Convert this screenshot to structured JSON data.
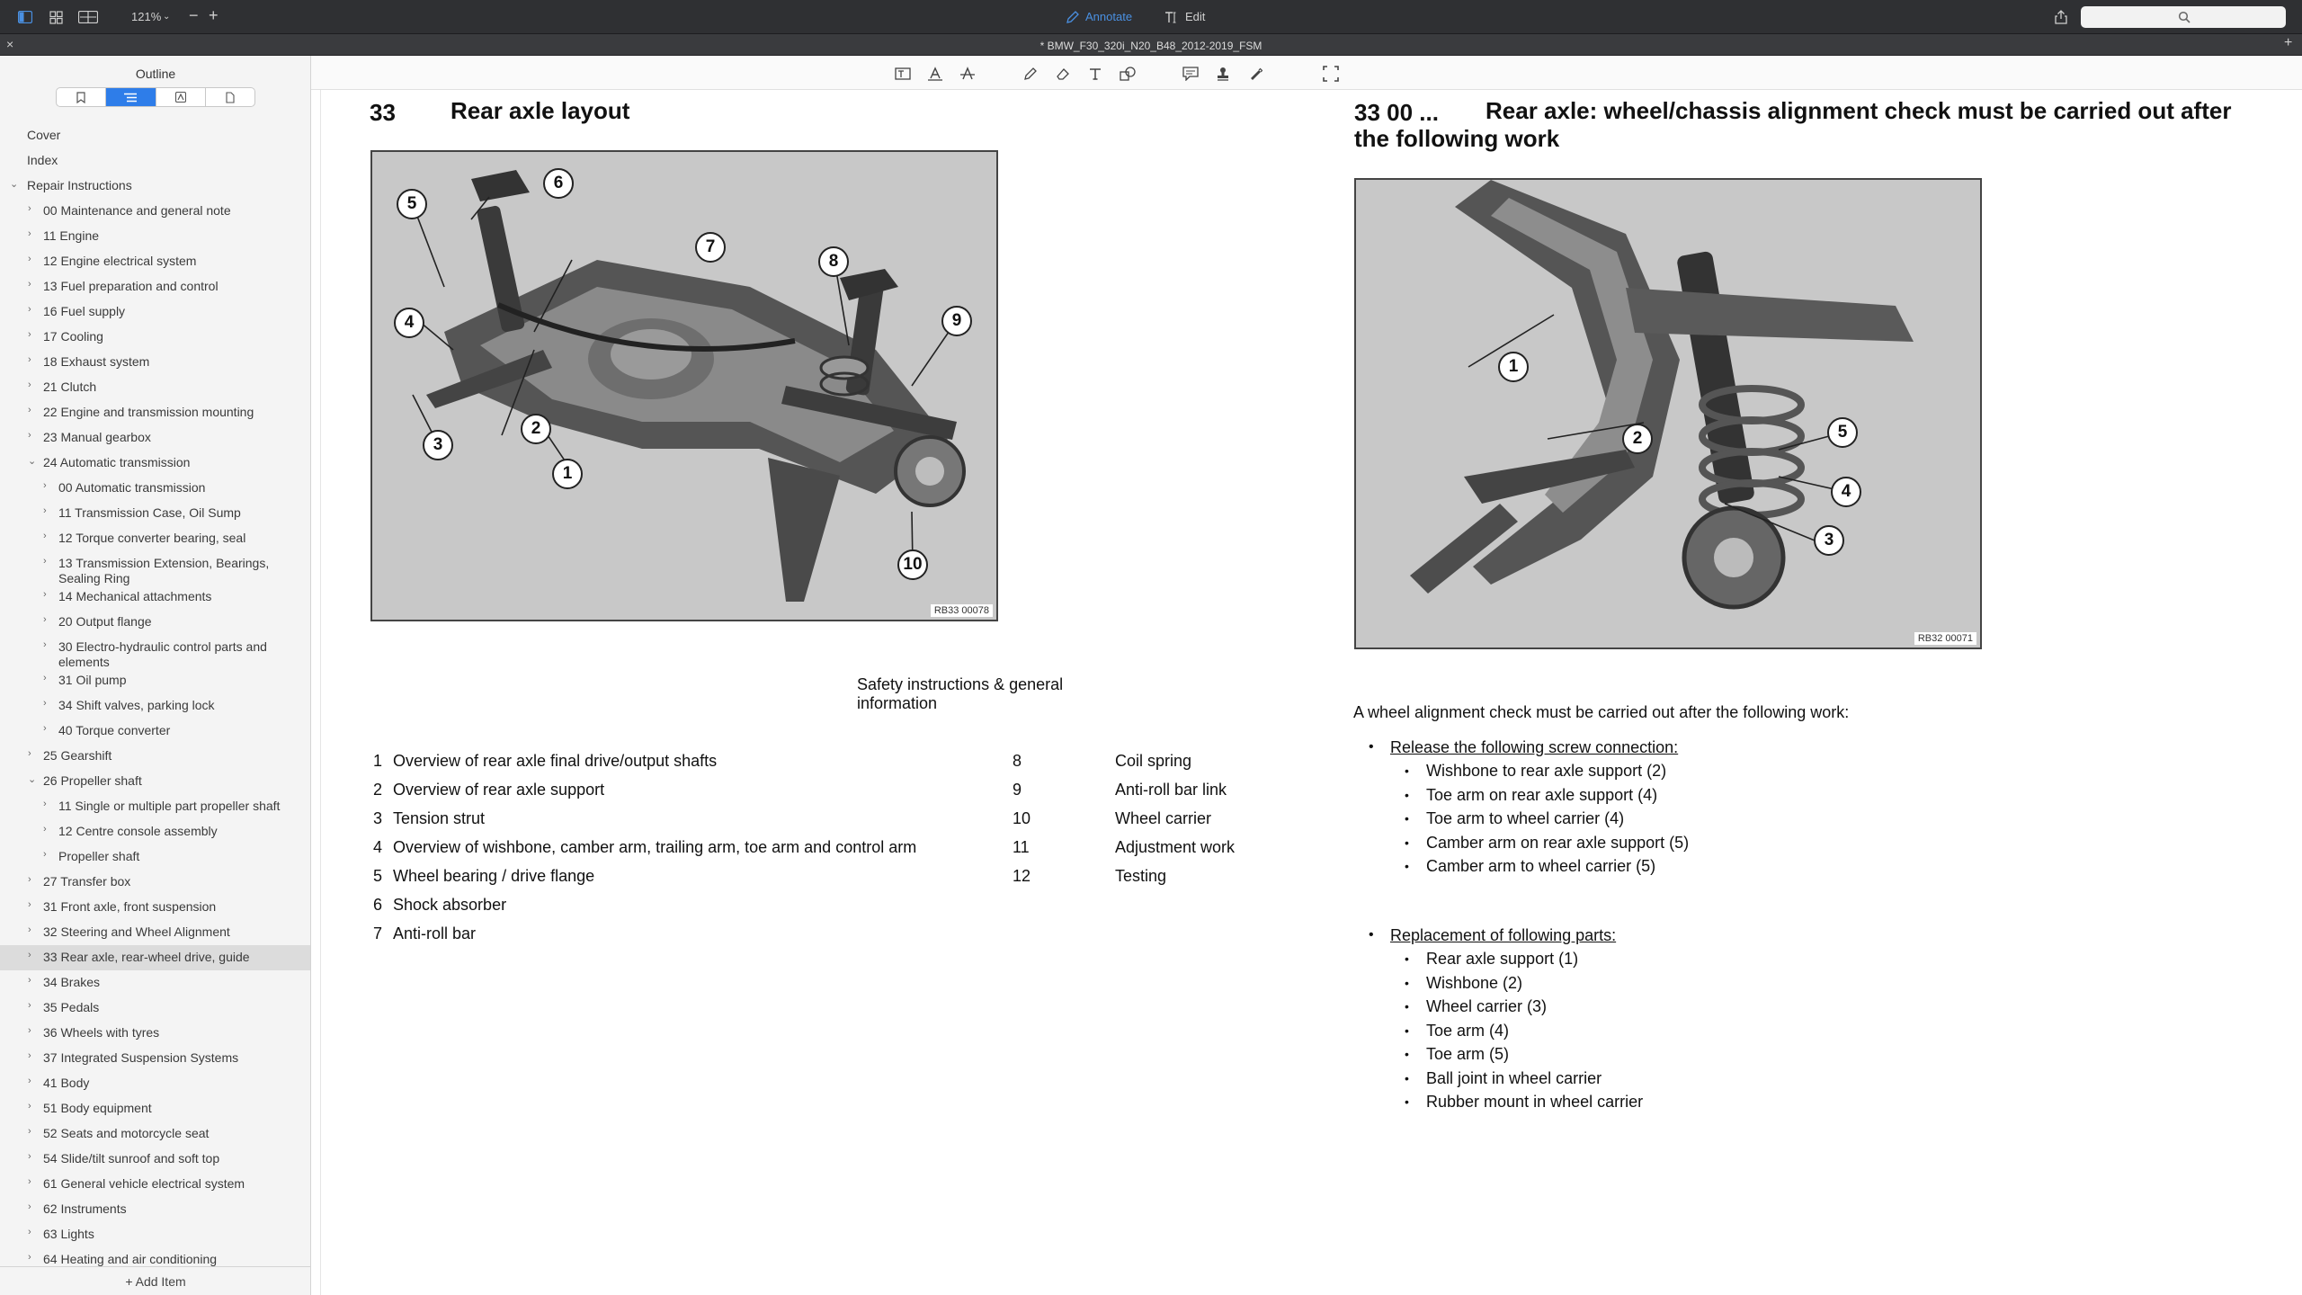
{
  "toolbar": {
    "zoom": "121%",
    "annotate_label": "Annotate",
    "edit_label": "Edit",
    "search_placeholder": ""
  },
  "document": {
    "title": "* BMW_F30_320i_N20_B48_2012-2019_FSM"
  },
  "sidebar": {
    "title": "Outline",
    "add_item_label": "+ Add Item",
    "items": [
      {
        "label": "Cover",
        "level": 0,
        "chevron": ""
      },
      {
        "label": "Index",
        "level": 0,
        "chevron": ""
      },
      {
        "label": "Repair Instructions",
        "level": 0,
        "chevron": "⌄"
      },
      {
        "label": "00 Maintenance and general note",
        "level": 1,
        "chevron": "›"
      },
      {
        "label": "11 Engine",
        "level": 1,
        "chevron": "›"
      },
      {
        "label": "12 Engine electrical system",
        "level": 1,
        "chevron": "›"
      },
      {
        "label": "13 Fuel preparation and control",
        "level": 1,
        "chevron": "›"
      },
      {
        "label": "16 Fuel supply",
        "level": 1,
        "chevron": "›"
      },
      {
        "label": "17 Cooling",
        "level": 1,
        "chevron": "›"
      },
      {
        "label": "18 Exhaust system",
        "level": 1,
        "chevron": "›"
      },
      {
        "label": "21 Clutch",
        "level": 1,
        "chevron": "›"
      },
      {
        "label": "22 Engine and transmission mounting",
        "level": 1,
        "chevron": "›"
      },
      {
        "label": "23 Manual gearbox",
        "level": 1,
        "chevron": "›"
      },
      {
        "label": "24 Automatic transmission",
        "level": 1,
        "chevron": "⌄"
      },
      {
        "label": "00 Automatic transmission",
        "level": 2,
        "chevron": "›"
      },
      {
        "label": "11 Transmission Case, Oil Sump",
        "level": 2,
        "chevron": "›"
      },
      {
        "label": "12 Torque converter bearing, seal",
        "level": 2,
        "chevron": "›"
      },
      {
        "label": "13 Transmission Extension, Bearings,",
        "label2": "Sealing Ring",
        "level": 2,
        "chevron": "›"
      },
      {
        "label": "14 Mechanical attachments",
        "level": 2,
        "chevron": "›"
      },
      {
        "label": "20 Output flange",
        "level": 2,
        "chevron": "›"
      },
      {
        "label": "30 Electro-hydraulic control parts and",
        "label2": "elements",
        "level": 2,
        "chevron": "›"
      },
      {
        "label": "31 Oil pump",
        "level": 2,
        "chevron": "›"
      },
      {
        "label": "34 Shift valves, parking lock",
        "level": 2,
        "chevron": "›"
      },
      {
        "label": "40 Torque converter",
        "level": 2,
        "chevron": "›"
      },
      {
        "label": "25 Gearshift",
        "level": 1,
        "chevron": "›"
      },
      {
        "label": "26 Propeller shaft",
        "level": 1,
        "chevron": "⌄"
      },
      {
        "label": "11 Single or multiple part propeller shaft",
        "level": 2,
        "chevron": "›"
      },
      {
        "label": "12 Centre console assembly",
        "level": 2,
        "chevron": "›"
      },
      {
        "label": "Propeller shaft",
        "level": 2,
        "chevron": "›"
      },
      {
        "label": "27 Transfer box",
        "level": 1,
        "chevron": "›"
      },
      {
        "label": "31 Front axle, front suspension",
        "level": 1,
        "chevron": "›"
      },
      {
        "label": "32 Steering and Wheel Alignment",
        "level": 1,
        "chevron": "›"
      },
      {
        "label": "33 Rear axle, rear-wheel drive, guide",
        "level": 1,
        "chevron": "›",
        "selected": true
      },
      {
        "label": "34 Brakes",
        "level": 1,
        "chevron": "›"
      },
      {
        "label": "35 Pedals",
        "level": 1,
        "chevron": "›"
      },
      {
        "label": "36 Wheels with tyres",
        "level": 1,
        "chevron": "›"
      },
      {
        "label": "37 Integrated Suspension Systems",
        "level": 1,
        "chevron": "›"
      },
      {
        "label": "41 Body",
        "level": 1,
        "chevron": "›"
      },
      {
        "label": "51 Body equipment",
        "level": 1,
        "chevron": "›"
      },
      {
        "label": "52 Seats and motorcycle seat",
        "level": 1,
        "chevron": "›"
      },
      {
        "label": "54 Slide/tilt sunroof and soft top",
        "level": 1,
        "chevron": "›"
      },
      {
        "label": "61 General vehicle electrical system",
        "level": 1,
        "chevron": "›"
      },
      {
        "label": "62 Instruments",
        "level": 1,
        "chevron": "›"
      },
      {
        "label": "63 Lights",
        "level": 1,
        "chevron": "›"
      },
      {
        "label": "64 Heating and air conditioning",
        "level": 1,
        "chevron": "›"
      }
    ]
  },
  "left_page": {
    "number": "33",
    "title": "Rear axle layout",
    "figure_code": "RB33 00078",
    "callouts": [
      "1",
      "2",
      "3",
      "4",
      "5",
      "6",
      "7",
      "8",
      "9",
      "10"
    ],
    "safety_line1": "Safety instructions & general",
    "safety_line2": "information",
    "index_left": [
      {
        "num": "1",
        "text": "Overview of rear axle final drive/output shafts"
      },
      {
        "num": "2",
        "text": "Overview of rear axle support"
      },
      {
        "num": "3",
        "text": "Tension strut"
      },
      {
        "num": "4",
        "text": "Overview of wishbone, camber arm, trailing arm, toe arm and control arm"
      },
      {
        "num": "5",
        "text": "Wheel bearing / drive flange"
      },
      {
        "num": "6",
        "text": "Shock absorber"
      },
      {
        "num": "7",
        "text": "Anti-roll bar"
      }
    ],
    "index_right": [
      {
        "num": "8",
        "text": "Coil spring"
      },
      {
        "num": "9",
        "text": "Anti-roll bar link"
      },
      {
        "num": "10",
        "text": "Wheel carrier"
      },
      {
        "num": "11",
        "text": "Adjustment work"
      },
      {
        "num": "12",
        "text": "Testing"
      }
    ]
  },
  "right_page": {
    "number": "33 00 ...",
    "title_line1": "Rear axle: wheel/chassis alignment check must be carried out after",
    "title_line2": "the following work",
    "figure_code": "RB32 00071",
    "callouts": [
      "1",
      "2",
      "3",
      "4",
      "5"
    ],
    "intro": "A wheel alignment check must be carried out after the following work:",
    "section1_heading": "Release the following screw connection:",
    "section1_items": [
      "Wishbone to rear axle support (2)",
      "Toe arm on rear axle support (4)",
      "Toe arm to wheel carrier (4)",
      "Camber arm on rear axle support (5)",
      "Camber arm to wheel carrier (5)"
    ],
    "section2_heading": "Replacement of following parts:",
    "section2_items": [
      "Rear axle support (1)",
      "Wishbone (2)",
      "Wheel carrier (3)",
      "Toe arm (4)",
      "Toe arm (5)",
      "Ball joint in wheel carrier",
      "Rubber mount in wheel carrier"
    ]
  }
}
